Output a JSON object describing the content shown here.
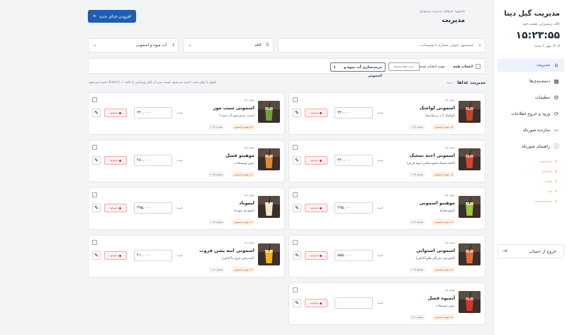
{
  "app": {
    "title": "مدیریت گیل دیتا",
    "subtitle": "کافه رستوران، هست فود",
    "clock": "۱۵:۲۳:۵۵",
    "date": "۱۴۰۵ مهر ۶ شنبه"
  },
  "nav": [
    {
      "label": "مدیریت",
      "icon": "home-icon",
      "active": true
    },
    {
      "label": "دسته‌بندی‌ها",
      "icon": "grid-icon"
    },
    {
      "label": "تنظیمات",
      "icon": "gear-icon"
    },
    {
      "label": "ورود و خروج اطلاعات",
      "icon": "sync-icon"
    },
    {
      "label": "سازنده شورتکد",
      "icon": "code-icon"
    },
    {
      "label": "راهنمای شورتکد",
      "icon": "info-icon"
    }
  ],
  "logout": "خروج از حساب",
  "header": {
    "breadcrumb": "داشبورد حرفه‌ای مدیریت رستوران",
    "title": "مدیریت",
    "add_button": "افزودن غذای جدید"
  },
  "filters": {
    "search_placeholder": "جستجوی عنوان، شماره یا توضیحات...",
    "category": "کافه",
    "subcategory": "آب میوه و اسمونی"
  },
  "bulk": {
    "select_all": "انتخاب همه",
    "selected_count": "۰ مورد انتخاب شده",
    "delete_label": "حذف انتخاب‌شده‌ها",
    "sort_value": "مرتب‌سازی آب میوه و اسمونی"
  },
  "list": {
    "title": "مدیریت غذاها",
    "count": "۱۰ غذا",
    "hint": "عنوان یا توان تایپ ذخیره می‌شود، قیمت پس از پایان ویرایش یا دکمه ✓ یا Enter ذخیره می‌شود."
  },
  "price_label": "قیمت",
  "badge_label": "ناموجود",
  "items": [
    {
      "category": "عنوان غذا",
      "name": "اسمونی لواشک",
      "desc": "(لواشک آب زرشک‌پنج)",
      "price": "۴۴۰,۰۰۰",
      "tag1": "آب میوه و اسمونی",
      "tag2": "شماره ۱۰۶۲",
      "hue": "#c2452a"
    },
    {
      "category": "عنوان غذا",
      "name": "اسمونی سیب موز",
      "desc": "(سیب ترش،موز،آب سیب)",
      "price": "۴۴۰,۰۰۰",
      "tag1": "آب میوه و اسمونی",
      "tag2": "شماره ۱۰۶۳",
      "hue": "#6ea33b"
    },
    {
      "category": "عنوان غذا",
      "name": "اسمونی اخته تمشک",
      "desc": "(اخته،تمشک،لیمو،میکس میوه قرمز)",
      "price": "۴۴۰,۰۰۰",
      "tag1": "آب میوه و اسمونی",
      "tag2": "شماره ۱۰۶۴",
      "hue": "#d6452f"
    },
    {
      "category": "عنوان غذا",
      "name": "موهیتو فصل",
      "desc": "بدون توضیحات",
      "price": "۴۸۰,۰۰۰",
      "tag1": "آب میوه و اسمونی",
      "tag2": "شماره ۱۰۶۵",
      "hue": "#e08a2a"
    },
    {
      "category": "عنوان غذا",
      "name": "موهیتو اسمونی",
      "desc": "(لیمو،نعناع)",
      "price": "۲۹۵,۰۰۰",
      "tag1": "آب میوه و اسمونی",
      "tag2": "شماره ۱۰۶۶",
      "hue": "#9cc43c"
    },
    {
      "category": "عنوان غذا",
      "name": "لیموناد",
      "desc": "(لیمو،نخ سوده)",
      "price": "۲۹۵,۰۰۰",
      "tag1": "آب میوه و اسمونی",
      "tag2": "شماره ۱۰۶۷",
      "hue": "#f2e7c4"
    },
    {
      "category": "عنوان غذا",
      "name": "اسمونی استوایی",
      "desc": "(آبجو،توت فرنگی،هلو،آناناس)",
      "price": "۵۵۵,۰۰۰",
      "tag1": "آب میوه و اسمونی",
      "tag2": "شماره ۱۰۶۸",
      "hue": "#e26a3a"
    },
    {
      "category": "عنوان غذا",
      "name": "اسمونی انبه پشن فروت",
      "desc": "(انبه،پشن فروت،آناناس)",
      "price": "۴۱۰,۰۰۰",
      "tag1": "آب میوه و اسمونی",
      "tag2": "شماره ۱۰۶۹",
      "hue": "#f2b21c"
    },
    {
      "category": "عنوان غذا",
      "name": "آبمیوه فصل",
      "desc": "بدون توضیحات",
      "price": "۰",
      "tag1": "آب میوه و اسمونی",
      "tag2": "شماره ۱۰۷۰",
      "hue": "#d7332a"
    }
  ],
  "colors": {
    "primary": "#1d5db4",
    "danger": "#dc2626",
    "tag": "#fdf0e1"
  }
}
